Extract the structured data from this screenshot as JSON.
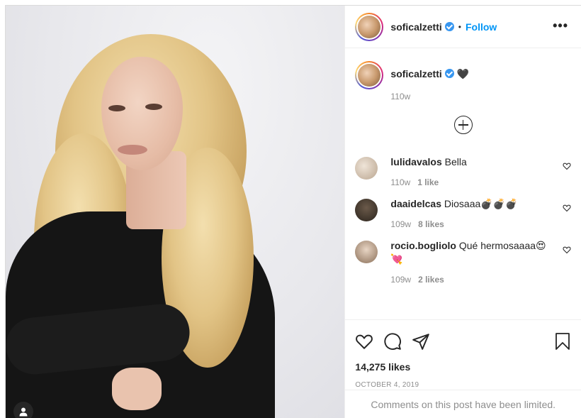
{
  "post": {
    "username": "soficalzetti",
    "follow_label": "Follow",
    "separator": "•",
    "more_label": "•••",
    "caption": {
      "username": "soficalzetti",
      "text": "🖤",
      "time": "110w"
    },
    "comments": [
      {
        "username": "lulidavalos",
        "text": "Bella",
        "time": "110w",
        "likes": "1 like"
      },
      {
        "username": "daaidelcas",
        "text": "Diosaaa💣💣💣",
        "time": "109w",
        "likes": "8 likes"
      },
      {
        "username": "rocio.bogliolo",
        "text": "Qué hermosaaaa😍💘",
        "time": "109w",
        "likes": "2 likes"
      }
    ],
    "like_count": "14,275 likes",
    "date": "OCTOBER 4, 2019",
    "comments_limited": "Comments on this post have been limited."
  },
  "icons": {
    "verified": "verified-badge-icon",
    "more": "more-options-icon",
    "load_more": "plus-circle-icon",
    "heart": "heart-icon",
    "comment": "comment-icon",
    "share": "share-icon",
    "save": "bookmark-icon",
    "user_tag": "user-tag-icon"
  },
  "colors": {
    "link": "#0095f6",
    "verified": "#3897f0",
    "muted": "#8e8e8e",
    "text": "#262626"
  }
}
